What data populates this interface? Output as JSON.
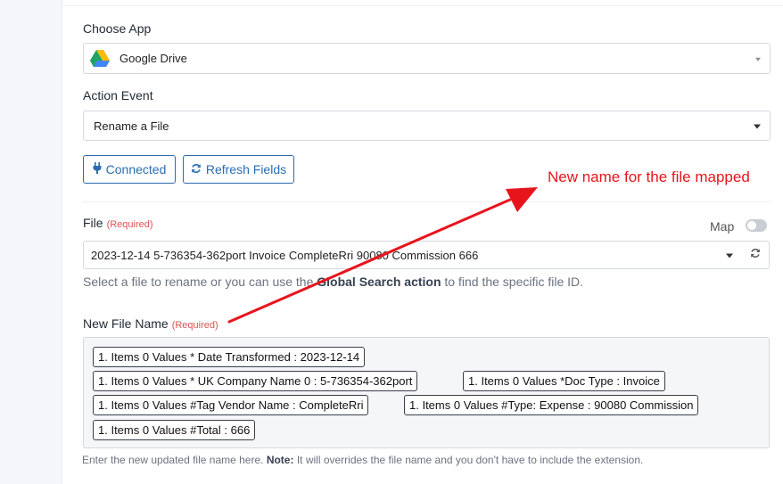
{
  "choose_app": {
    "label": "Choose App",
    "selected": "Google Drive",
    "icon": "google-drive-icon"
  },
  "action_event": {
    "label": "Action Event",
    "selected": "Rename a File"
  },
  "buttons": {
    "connected": "Connected",
    "refresh_fields": "Refresh Fields"
  },
  "file": {
    "label": "File",
    "required": "(Required)",
    "map_label": "Map",
    "selected": "2023-12-14 5-736354-362port Invoice CompleteRri 90080 Commission 666",
    "hint_pre": "Select a file to rename or you can use the ",
    "hint_bold": "Global Search action",
    "hint_post": " to find the specific file ID."
  },
  "new_file_name": {
    "label": "New File Name",
    "required": "(Required)",
    "chips": [
      "1. Items 0 Values * Date Transformed : 2023-12-14",
      "1. Items 0 Values * UK Company Name 0 : 5-736354-362port",
      "1. Items 0 Values *Doc Type : Invoice",
      "1. Items 0 Values #Tag Vendor Name : CompleteRri",
      "1. Items 0 Values #Type: Expense : 90080 Commission",
      "1. Items 0 Values #Total : 666"
    ],
    "hint_pre": "Enter the new updated file name here. ",
    "hint_bold": "Note:",
    "hint_post": " It will overrides the file name and you don't have to include the extension."
  },
  "annotation": {
    "text": "New name for the file mapped",
    "color": "#e8141c"
  }
}
